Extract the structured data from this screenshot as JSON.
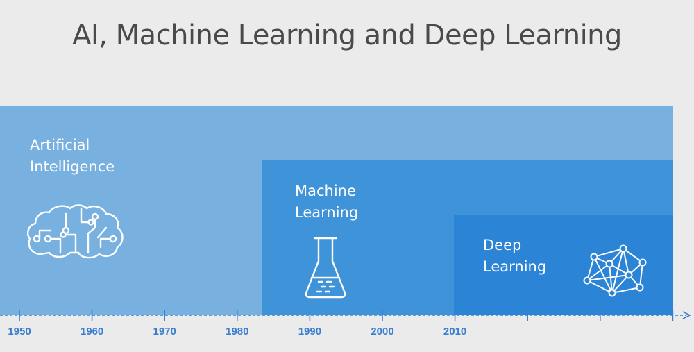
{
  "title": "AI, Machine Learning and Deep Learning",
  "bands": [
    {
      "id": "ai",
      "lines": [
        "Artificial",
        "Intelligence"
      ],
      "icon": "brain-circuit-icon",
      "color": "#78b0df"
    },
    {
      "id": "ml",
      "lines": [
        "Machine",
        "Learning"
      ],
      "icon": "flask-icon",
      "color": "#3f93d9"
    },
    {
      "id": "dl",
      "lines": [
        "Deep",
        "Learning"
      ],
      "icon": "neural-network-icon",
      "color": "#2b84d5"
    }
  ],
  "timeline": {
    "labels": [
      "1950",
      "1960",
      "1970",
      "1980",
      "1990",
      "2000",
      "2010"
    ],
    "color": "#3a7fcf"
  }
}
